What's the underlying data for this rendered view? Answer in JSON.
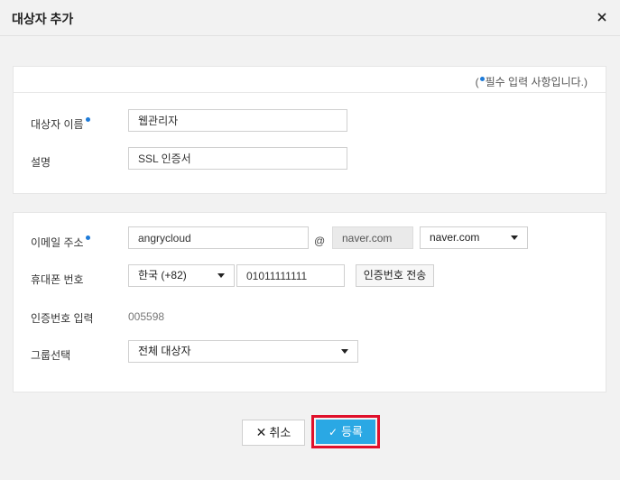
{
  "dialog": {
    "title": "대상자 추가",
    "close_icon": "close-icon"
  },
  "required_note": {
    "prefix": "(",
    "text": "필수 입력 사항입니다.)"
  },
  "section1": {
    "name_label": "대상자 이름",
    "name_value": "웹관리자",
    "desc_label": "설명",
    "desc_value": "SSL 인증서"
  },
  "section2": {
    "email_label": "이메일 주소",
    "email_local": "angrycloud",
    "email_at": "@",
    "email_domain": "naver.com",
    "email_domain_select": "naver.com",
    "phone_label": "휴대폰 번호",
    "country_select": "한국 (+82)",
    "phone_value": "01011111111",
    "send_code_button": "인증번호 전송",
    "code_label": "인증번호 입력",
    "code_value": "005598",
    "group_label": "그룹선택",
    "group_select": "전체 대상자"
  },
  "footer": {
    "cancel_label": "취소",
    "submit_label": "등록"
  },
  "colors": {
    "accent": "#2aa8e4",
    "required_dot": "#1e7bd8",
    "highlight": "#e0102b"
  }
}
